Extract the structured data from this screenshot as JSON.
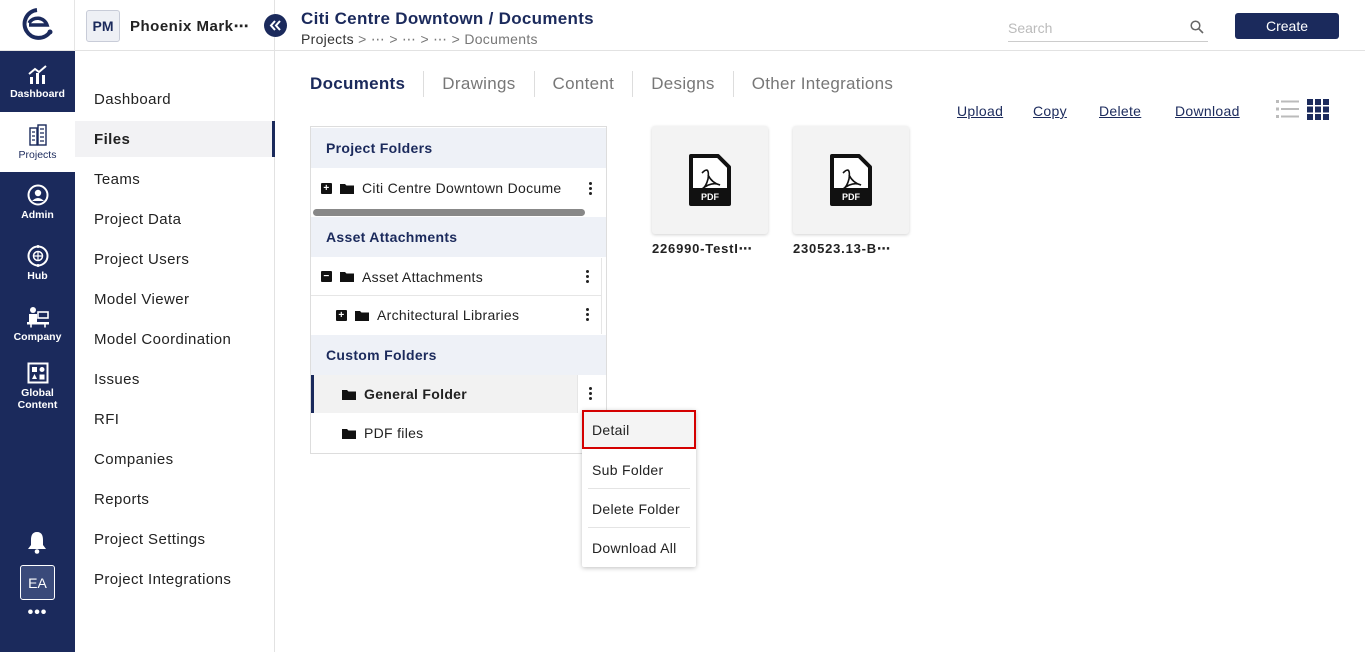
{
  "rail": {
    "items": [
      {
        "label": "Dashboard",
        "icon": "chart-up-icon"
      },
      {
        "label": "Projects",
        "icon": "buildings-icon"
      },
      {
        "label": "Admin",
        "icon": "admin-icon"
      },
      {
        "label": "Hub",
        "icon": "hub-icon"
      },
      {
        "label": "Company",
        "icon": "company-icon"
      },
      {
        "label": "Global Content",
        "icon": "global-content-icon"
      }
    ],
    "avatar": "EA",
    "more": "•••"
  },
  "project": {
    "initials": "PM",
    "name": "Phoenix Mark⋯"
  },
  "nav": {
    "items": [
      "Dashboard",
      "Files",
      "Teams",
      "Project Data",
      "Project Users",
      "Model Viewer",
      "Model Coordination",
      "Issues",
      "RFI",
      "Companies",
      "Reports",
      "Project Settings",
      "Project Integrations"
    ],
    "active": "Files"
  },
  "header": {
    "title": "Citi Centre Downtown / Documents",
    "breadcrumb_root": "Projects",
    "breadcrumb_trail": " > ⋯ > ⋯ > ⋯ > ",
    "breadcrumb_current": "Documents",
    "search_placeholder": "Search",
    "create_label": "Create"
  },
  "tabs": [
    "Documents",
    "Drawings",
    "Content",
    "Designs",
    "Other Integrations"
  ],
  "actions": {
    "upload": "Upload",
    "copy": "Copy",
    "delete": "Delete",
    "download": "Download"
  },
  "folders": {
    "project_head": "Project Folders",
    "project_row": "Citi Centre Downtown Docume",
    "asset_head": "Asset Attachments",
    "asset_row": "Asset Attachments",
    "arch_row": "Architectural Libraries",
    "custom_head": "Custom Folders",
    "general_row": "General Folder",
    "pdf_row": "PDF files"
  },
  "context_menu": [
    "Detail",
    "Sub Folder",
    "Delete Folder",
    "Download All"
  ],
  "files": [
    {
      "name": "226990-TestI⋯",
      "badge": "PDF"
    },
    {
      "name": "230523.13-B⋯",
      "badge": "PDF"
    }
  ],
  "colors": {
    "brand": "#1b2a5c",
    "highlight": "#d40000"
  }
}
